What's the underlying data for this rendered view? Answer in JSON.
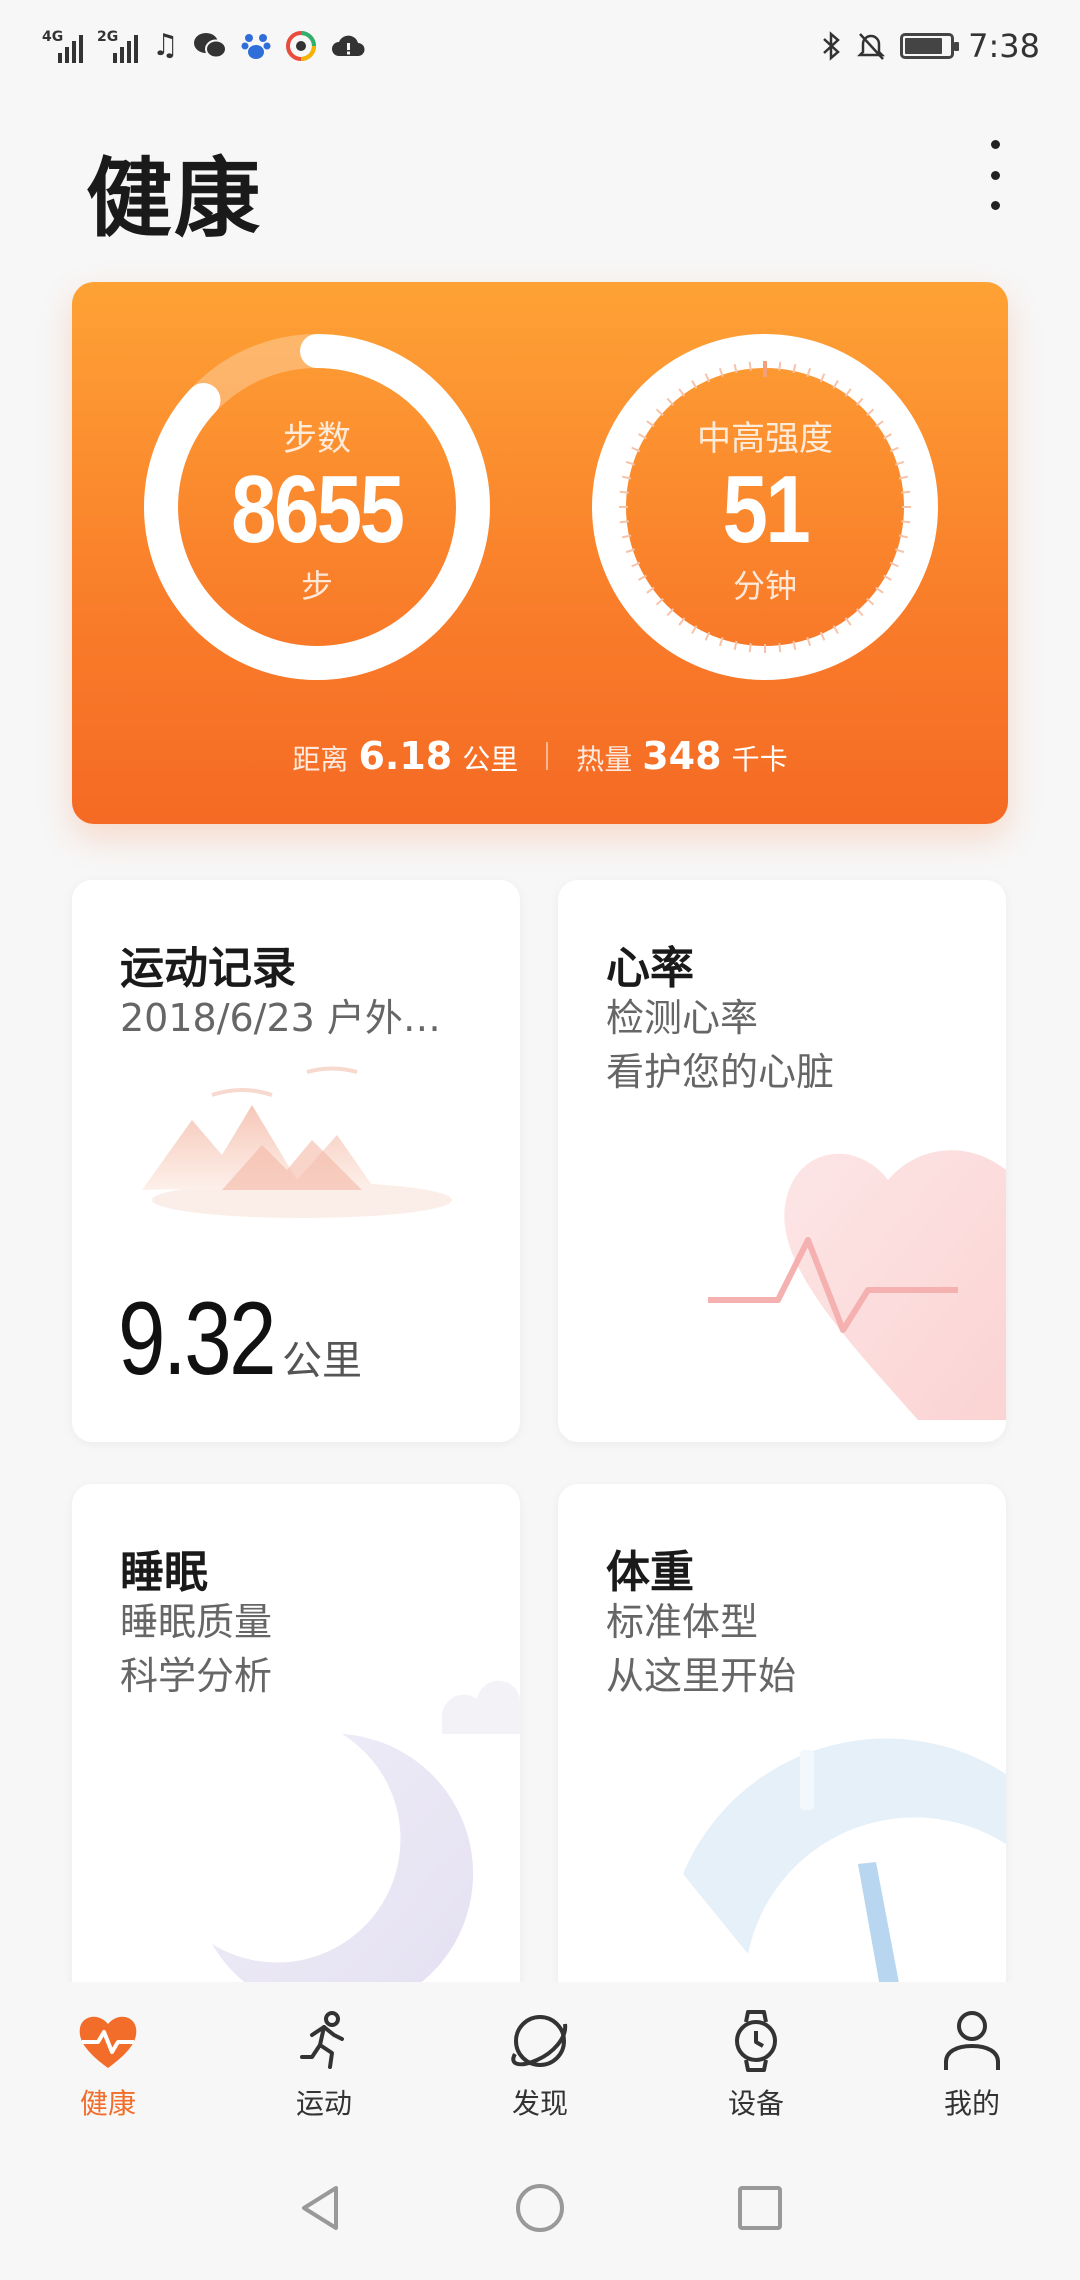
{
  "status_bar": {
    "network_1": "4G",
    "network_2": "2G",
    "time": "7:38",
    "battery_level": 0.85
  },
  "header": {
    "title": "健康"
  },
  "summary_card": {
    "steps_label": "步数",
    "steps_value": "8655",
    "steps_unit": "步",
    "steps_progress": 0.87,
    "intensity_label": "中高强度",
    "intensity_value": "51",
    "intensity_unit": "分钟",
    "distance_label": "距离",
    "distance_value": "6.18",
    "distance_unit": "公里",
    "calories_label": "热量",
    "calories_value": "348",
    "calories_unit": "千卡",
    "colors": {
      "gradient_top": "#fea235",
      "gradient_bottom": "#f56a24"
    }
  },
  "cards": {
    "exercise": {
      "title": "运动记录",
      "subtitle": "2018/6/23 户外…",
      "distance": "9.32",
      "distance_unit": "公里"
    },
    "heart_rate": {
      "title": "心率",
      "line1": "检测心率",
      "line2": "看护您的心脏"
    },
    "sleep": {
      "title": "睡眠",
      "line1": "睡眠质量",
      "line2": "科学分析"
    },
    "weight": {
      "title": "体重",
      "line1": "标准体型",
      "line2": "从这里开始"
    }
  },
  "tabs": [
    {
      "label": "健康",
      "icon": "heart-pulse-icon",
      "active": true
    },
    {
      "label": "运动",
      "icon": "running-icon",
      "active": false
    },
    {
      "label": "发现",
      "icon": "planet-icon",
      "active": false
    },
    {
      "label": "设备",
      "icon": "watch-icon",
      "active": false
    },
    {
      "label": "我的",
      "icon": "person-icon",
      "active": false
    }
  ],
  "accent_color": "#f36d2a"
}
